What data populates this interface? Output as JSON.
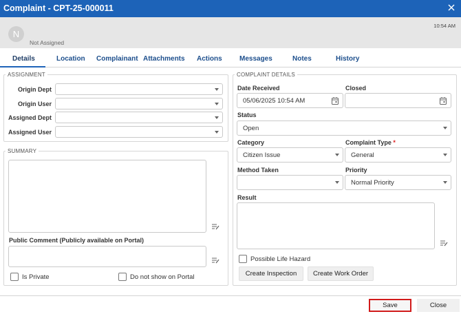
{
  "window": {
    "title": "Complaint - CPT-25-000011"
  },
  "user": {
    "avatar_letter": "N",
    "assignee": "Not Assigned",
    "time": "10:54 AM"
  },
  "tabs": [
    {
      "label": "Details"
    },
    {
      "label": "Location"
    },
    {
      "label": "Complainant"
    },
    {
      "label": "Attachments"
    },
    {
      "label": "Actions"
    },
    {
      "label": "Messages"
    },
    {
      "label": "Notes"
    },
    {
      "label": "History"
    }
  ],
  "assignment": {
    "legend": "ASSIGNMENT",
    "origin_dept_label": "Origin Dept",
    "origin_dept_value": "",
    "origin_user_label": "Origin User",
    "origin_user_value": "",
    "assigned_dept_label": "Assigned Dept",
    "assigned_dept_value": "",
    "assigned_user_label": "Assigned User",
    "assigned_user_value": ""
  },
  "summary": {
    "legend": "SUMMARY",
    "text": "",
    "public_comment_label": "Public Comment (Publicly available on Portal)",
    "public_comment": "",
    "is_private_label": "Is Private",
    "not_on_portal_label": "Do not show on Portal"
  },
  "details": {
    "legend": "COMPLAINT DETAILS",
    "date_received_label": "Date Received",
    "date_received": "05/06/2025 10:54 AM",
    "closed_label": "Closed",
    "closed": "",
    "status_label": "Status",
    "status": "Open",
    "category_label": "Category",
    "category": "Citizen Issue",
    "complaint_type_label": "Complaint Type",
    "required_mark": "*",
    "complaint_type": "General",
    "method_label": "Method Taken",
    "method": "",
    "priority_label": "Priority",
    "priority": "Normal Priority",
    "result_label": "Result",
    "result": "",
    "life_hazard_label": "Possible Life Hazard",
    "create_inspection": "Create Inspection",
    "create_work_order": "Create Work Order"
  },
  "footer": {
    "save": "Save",
    "close": "Close"
  },
  "colors": {
    "titlebar": "#1d63b8",
    "tab_text": "#1c4e8c",
    "save_outline": "#d11a1a"
  },
  "icons": {
    "close": "close-icon",
    "calendar": "calendar-icon",
    "edit": "edit-text-icon",
    "dropdown": "chevron-down-icon"
  }
}
